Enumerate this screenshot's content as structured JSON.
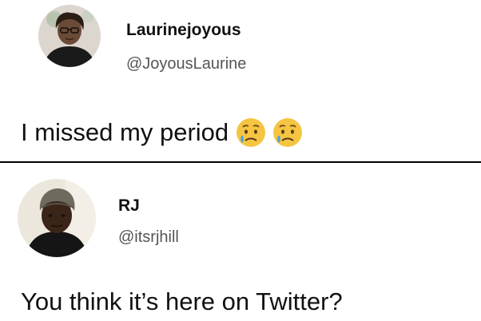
{
  "tweets": [
    {
      "display_name": "Laurinejoyous",
      "handle": "@JoyousLaurine",
      "text": "I missed my period",
      "emoji": [
        "sad-but-relieved-face-icon",
        "sad-but-relieved-face-icon"
      ],
      "avatar": "profile-photo-woman"
    },
    {
      "display_name": "RJ",
      "handle": "@itsrjhill",
      "text": "You think it’s here on Twitter?",
      "avatar": "profile-photo-man-beanie"
    }
  ],
  "colors": {
    "background": "#ffffff",
    "text": "#111111",
    "handle": "#555555",
    "divider": "#000000",
    "emoji_face": "#f5c542"
  }
}
